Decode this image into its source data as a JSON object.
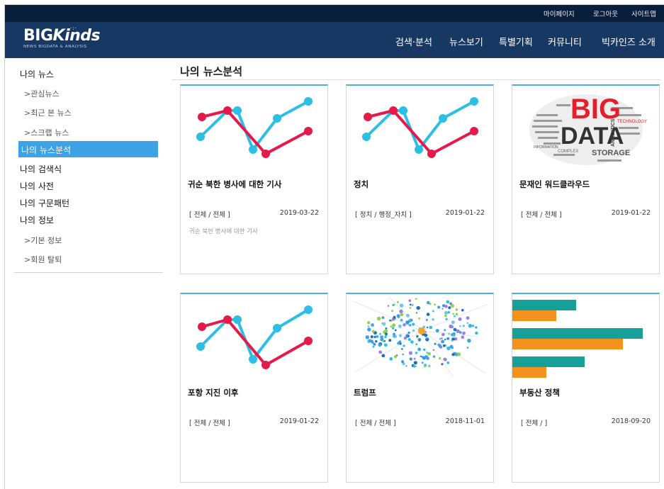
{
  "util_links": [
    "마이페이지",
    "로그아웃",
    "사이트맵"
  ],
  "logo": {
    "main_a": "BIG",
    "main_b": "Kinds",
    "sub": "NEWS BIGDATA & ANALYSIS"
  },
  "gnb": [
    "검색·분석",
    "뉴스보기",
    "특별기획",
    "커뮤니티",
    "빅카인즈 소개"
  ],
  "sidebar": {
    "items": [
      {
        "label": "나의 뉴스",
        "type": "main"
      },
      {
        "label": ">관심뉴스",
        "type": "sub"
      },
      {
        "label": ">최근 본 뉴스",
        "type": "sub"
      },
      {
        "label": ">스크랩 뉴스",
        "type": "sub"
      },
      {
        "label": "나의 뉴스분석",
        "type": "active"
      },
      {
        "label": "나의 검색식",
        "type": "main"
      },
      {
        "label": "나의 사전",
        "type": "main"
      },
      {
        "label": "나의 구문패턴",
        "type": "main"
      },
      {
        "label": "나의 정보",
        "type": "main"
      },
      {
        "label": ">기본 정보",
        "type": "sub"
      },
      {
        "label": ">회원 탈퇴",
        "type": "sub"
      }
    ]
  },
  "page_title": "나의 뉴스분석",
  "cards": [
    {
      "title": "귀순 북한 병사에 대한 기사",
      "category": "[ 전체 / 전체 ]",
      "date": "2019-03-22",
      "description": "귀순 북한 병사에 대한 기사",
      "thumb": "line-chart-icon"
    },
    {
      "title": "정치",
      "category": "[ 정치 / 행정_자치 ]",
      "date": "2019-01-22",
      "description": "",
      "thumb": "line-chart-icon"
    },
    {
      "title": "문재인 워드클라우드",
      "category": "[ 전체 / 전체 ]",
      "date": "2019-01-22",
      "description": "",
      "thumb": "word-cloud-image"
    },
    {
      "title": "포항 지진 이후",
      "category": "[ 전체 / 전체 ]",
      "date": "2019-01-22",
      "description": "",
      "thumb": "line-chart-icon"
    },
    {
      "title": "트럼프",
      "category": "[ 전체 / 전체 ]",
      "date": "2018-11-01",
      "description": "",
      "thumb": "network-graph-image"
    },
    {
      "title": "부동산 정책",
      "category": "[ 전체 / ]",
      "date": "2018-09-20",
      "description": "",
      "thumb": "bar-chart-icon"
    }
  ],
  "wordcloud_words": [
    "BIG",
    "DATA",
    "STORAGE",
    "ANALYTICS",
    "TECHNOLOGY",
    "INFORMATION",
    "COMPLEX"
  ],
  "colors": {
    "util_bg": "#091e3b",
    "header_bg": "#183864",
    "accent": "#3ea2e6",
    "line_red": "#e5194a",
    "line_cyan": "#2bbfe6",
    "bar_teal": "#16a09a",
    "bar_orange": "#f4921e"
  }
}
